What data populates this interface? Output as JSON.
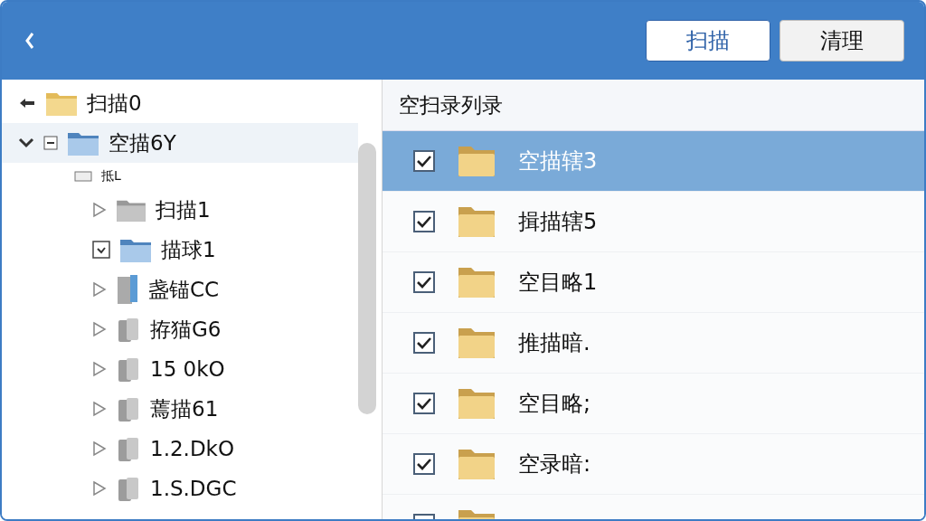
{
  "toolbar": {
    "buttons": [
      {
        "label": "扫描",
        "primary": true
      },
      {
        "label": "清理",
        "primary": false
      }
    ]
  },
  "tree": [
    {
      "label": "扫描0",
      "kind": "parent",
      "selected": false
    },
    {
      "label": "空描6Y",
      "kind": "folder",
      "expanded": true,
      "selected": true,
      "children": [
        {
          "label": "抵L",
          "kind": "group",
          "selected": false,
          "children": [
            {
              "label": "扫描1",
              "kind": "grayfolder",
              "expanded": false,
              "selected": false
            },
            {
              "label": "描球1",
              "kind": "folder",
              "expanded": true,
              "selected": false
            },
            {
              "label": "盏锚CC",
              "kind": "binder",
              "expanded": false,
              "selected": false
            },
            {
              "label": "拵猫G6",
              "kind": "stack",
              "expanded": false,
              "selected": false
            },
            {
              "label": "15 0kO",
              "kind": "stack",
              "expanded": false,
              "selected": false
            },
            {
              "label": "蔫描61",
              "kind": "stack",
              "expanded": false,
              "selected": false
            },
            {
              "label": "1.2.DkO",
              "kind": "stack",
              "expanded": false,
              "selected": false
            },
            {
              "label": "1.S.DGC",
              "kind": "stack",
              "expanded": false,
              "selected": false
            }
          ]
        }
      ]
    }
  ],
  "list": {
    "header": "空扫录列录",
    "rows": [
      {
        "label": "空描辖3",
        "checked": true,
        "selected": true
      },
      {
        "label": "揖描辖5",
        "checked": true,
        "selected": false
      },
      {
        "label": "空目略1",
        "checked": true,
        "selected": false
      },
      {
        "label": "推描暗.",
        "checked": true,
        "selected": false
      },
      {
        "label": "空目略;",
        "checked": true,
        "selected": false
      },
      {
        "label": "空录暗:",
        "checked": true,
        "selected": false
      },
      {
        "selected": false
      }
    ]
  }
}
